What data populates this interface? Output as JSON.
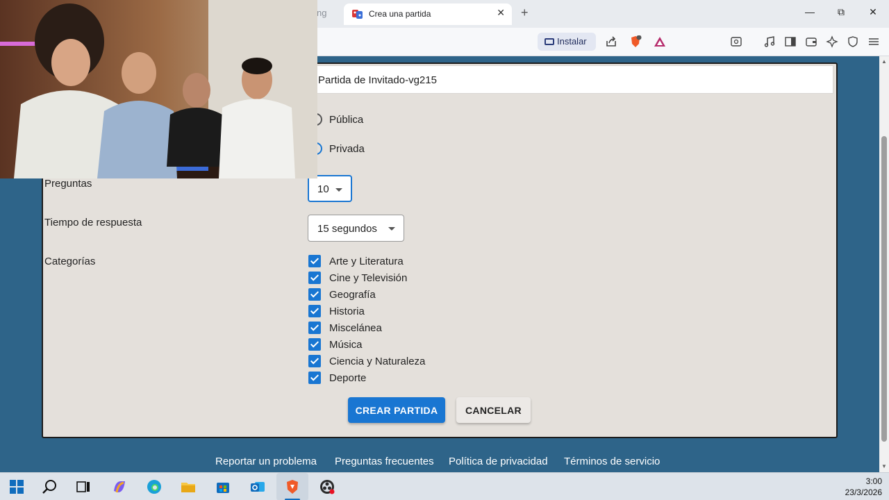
{
  "browser": {
    "faded_tab_text": "ng",
    "active_tab_title": "Crea una partida",
    "new_tab_symbol": "+",
    "close_symbol": "✕",
    "window_controls": {
      "minimize": "—",
      "maximize": "⧉",
      "close": "✕"
    },
    "install_label": "Instalar",
    "brave_badge": "2"
  },
  "form": {
    "game_name_value": "Partida de Invitado-vg215",
    "visibility_options": [
      "Pública",
      "Privada"
    ],
    "questions_label": "Preguntas",
    "questions_value": "10",
    "time_label": "Tiempo de respuesta",
    "time_value": "15 segundos",
    "categories_label": "Categorías",
    "categories": [
      "Arte y Literatura",
      "Cine y Televisión",
      "Geografía",
      "Historia",
      "Miscelánea",
      "Música",
      "Ciencia y Naturaleza",
      "Deporte"
    ],
    "create_button": "CREAR PARTIDA",
    "cancel_button": "CANCELAR"
  },
  "footer": {
    "links": [
      "Reportar un problema",
      "Preguntas frecuentes",
      "Política de privacidad",
      "Términos de servicio"
    ]
  },
  "taskbar": {
    "time": "3:00",
    "date": "23/3/2026"
  },
  "colors": {
    "accent": "#1976d2",
    "page_background": "#2e6489",
    "card_background": "#e4e0db"
  }
}
